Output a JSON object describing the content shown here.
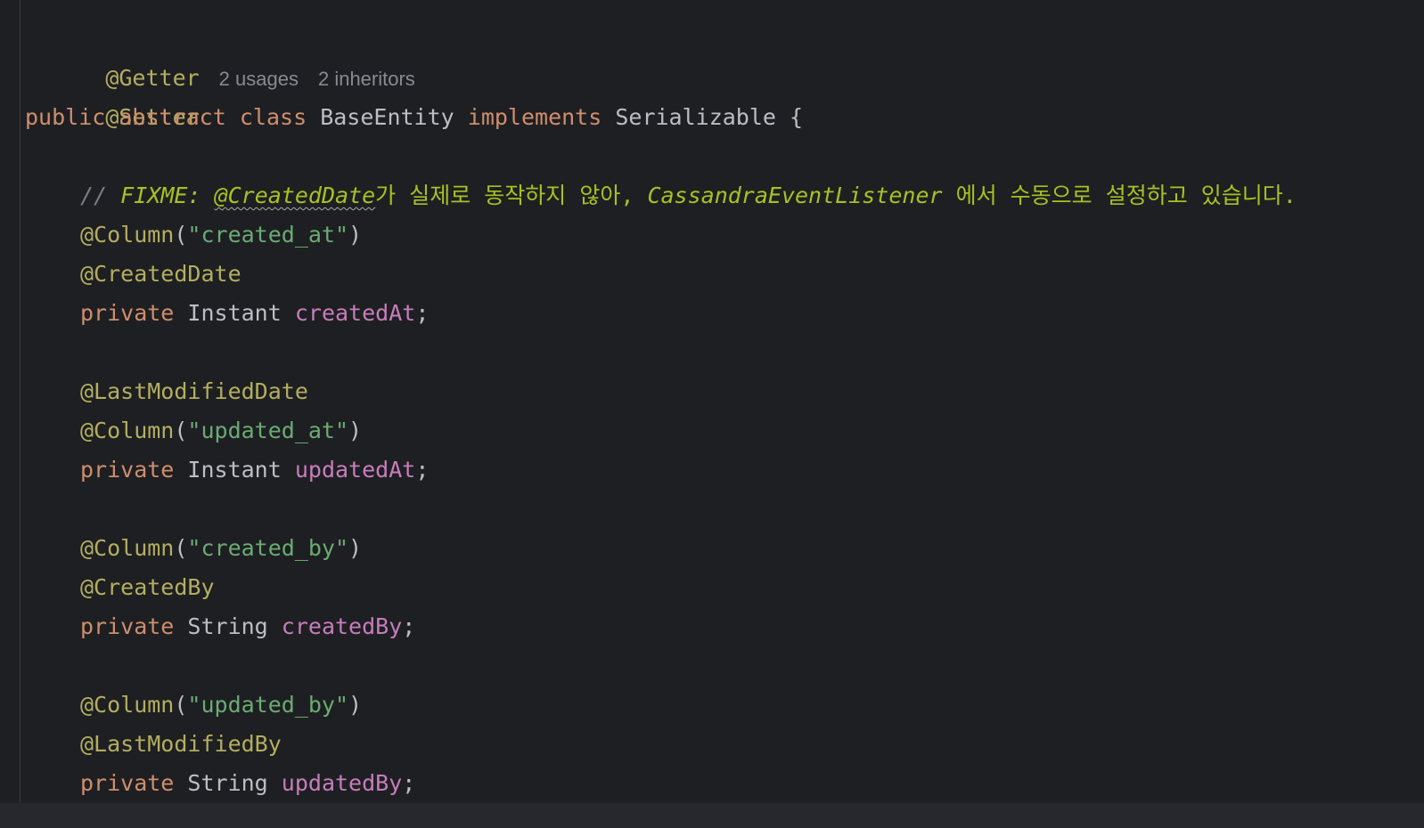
{
  "editor": {
    "line1": {
      "annotation": "@Getter",
      "hint_usages": "2 usages",
      "hint_inheritors": "2 inheritors"
    },
    "line2": {
      "annotation": "@Setter"
    },
    "line3": {
      "kw_public": "public",
      "kw_abstract": "abstract",
      "kw_class": "class",
      "class_name": "BaseEntity",
      "kw_implements": "implements",
      "interface_name": "Serializable",
      "brace": "{"
    },
    "comment": {
      "slashes": "//",
      "todo_tag": "FIXME:",
      "annotation_ref": "@CreatedDate",
      "text1": "가 실제로 동작하지 않아, ",
      "listener": "CassandraEventListener",
      "text2": " 에서 수동으로 설정하고 있습니다."
    },
    "field1": {
      "column_ann": "@Column",
      "column_value": "\"created_at\"",
      "extra_ann": "@CreatedDate",
      "modifier": "private",
      "type": "Instant",
      "name": "createdAt"
    },
    "field2": {
      "extra_ann": "@LastModifiedDate",
      "column_ann": "@Column",
      "column_value": "\"updated_at\"",
      "modifier": "private",
      "type": "Instant",
      "name": "updatedAt"
    },
    "field3": {
      "column_ann": "@Column",
      "column_value": "\"created_by\"",
      "extra_ann": "@CreatedBy",
      "modifier": "private",
      "type": "String",
      "name": "createdBy"
    },
    "field4": {
      "column_ann": "@Column",
      "column_value": "\"updated_by\"",
      "extra_ann": "@LastModifiedBy",
      "modifier": "private",
      "type": "String",
      "name": "updatedBy"
    },
    "punct": {
      "open_paren": "(",
      "close_paren": ")",
      "semicolon": ";"
    }
  }
}
